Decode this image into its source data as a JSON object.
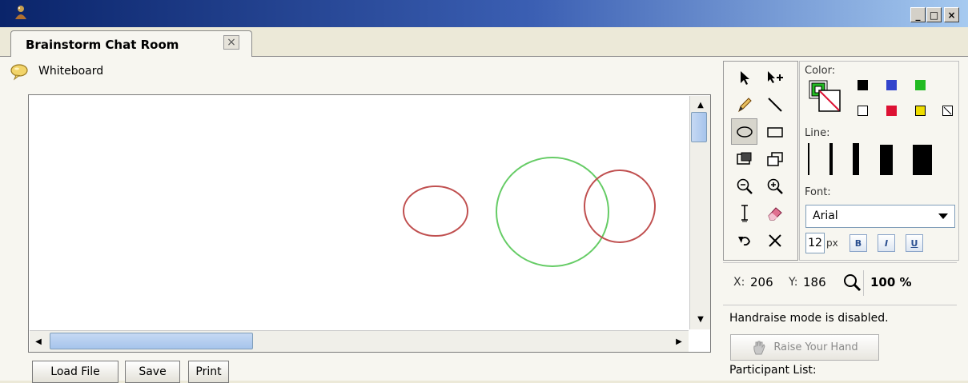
{
  "window": {
    "minimize_glyph": "_",
    "maximize_glyph": "□",
    "close_glyph": "×"
  },
  "tabs": [
    {
      "label": "Brainstorm Chat Room",
      "close_glyph": "×"
    }
  ],
  "whiteboard": {
    "label": "Whiteboard",
    "shapes": [
      {
        "type": "ellipse",
        "color": "#c05050"
      },
      {
        "type": "circle",
        "color": "#66cc66"
      },
      {
        "type": "circle",
        "color": "#c05050"
      }
    ]
  },
  "buttons": {
    "load_file": "Load File",
    "save": "Save",
    "print": "Print"
  },
  "tools": [
    "select-arrow-icon",
    "add-point-icon",
    "pencil-icon",
    "line-icon",
    "ellipse-icon",
    "rectangle-icon",
    "bring-front-icon",
    "send-back-icon",
    "zoom-out-icon",
    "zoom-in-icon",
    "text-cursor-icon",
    "eraser-icon",
    "undo-icon",
    "delete-icon"
  ],
  "color_panel": {
    "color_label": "Color:",
    "line_label": "Line:",
    "font_label": "Font:",
    "swatches": [
      "#000000",
      "#3344cc",
      "#22bb22",
      "#ffffff",
      "#dd1133",
      "#eedd00",
      "none"
    ],
    "font_name": "Arial",
    "font_size": "12",
    "font_size_suffix": "px",
    "bold": "B",
    "italic": "I",
    "underline": "U"
  },
  "status": {
    "x_label": "X:",
    "x_value": "206",
    "y_label": "Y:",
    "y_value": "186",
    "zoom": "100 %"
  },
  "handraise": {
    "message": "Handraise mode is disabled.",
    "button": "Raise Your Hand"
  },
  "participants": {
    "label": "Participant List:"
  }
}
